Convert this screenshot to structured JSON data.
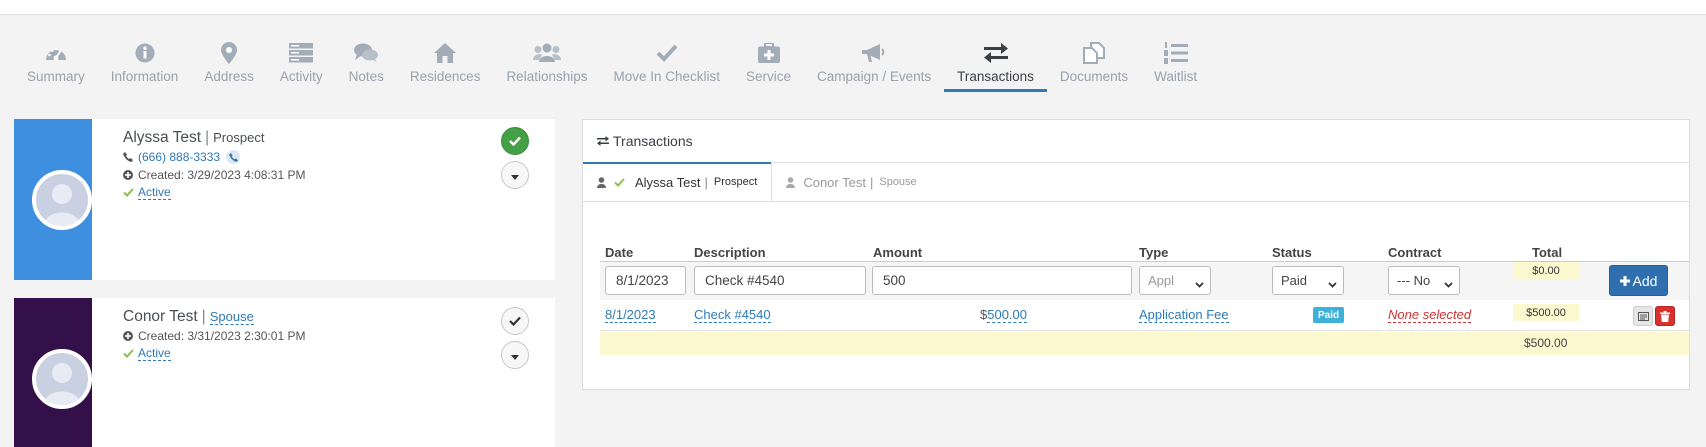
{
  "tabs": [
    {
      "label": "Summary",
      "icon": "dashboard-icon"
    },
    {
      "label": "Information",
      "icon": "info-icon"
    },
    {
      "label": "Address",
      "icon": "map-marker-icon"
    },
    {
      "label": "Activity",
      "icon": "server-icon"
    },
    {
      "label": "Notes",
      "icon": "comments-icon"
    },
    {
      "label": "Residences",
      "icon": "home-icon"
    },
    {
      "label": "Relationships",
      "icon": "users-icon"
    },
    {
      "label": "Move In Checklist",
      "icon": "check-icon"
    },
    {
      "label": "Service",
      "icon": "medkit-icon"
    },
    {
      "label": "Campaign / Events",
      "icon": "bullhorn-icon"
    },
    {
      "label": "Transactions",
      "icon": "exchange-icon"
    },
    {
      "label": "Documents",
      "icon": "files-icon"
    },
    {
      "label": "Waitlist",
      "icon": "list-ol-icon"
    }
  ],
  "active_tab": "Transactions",
  "people": [
    {
      "name": "Alyssa Test",
      "separator": "|",
      "relation": "Prospect",
      "phone": "(666) 888-3333",
      "created": "Created: 3/29/2023 4:08:31 PM",
      "status": "Active",
      "strip_color": "#3f8fe0"
    },
    {
      "name": "Conor Test",
      "separator": "|",
      "relation": "Spouse",
      "created": "Created: 3/31/2023 2:30:01 PM",
      "status": "Active",
      "strip_color": "#34104a"
    }
  ],
  "transactions": {
    "title": "Transactions",
    "subtabs": [
      {
        "name": "Alyssa Test",
        "sep": "|",
        "relation": "Prospect"
      },
      {
        "name": "Conor Test",
        "sep": "|",
        "relation": "Spouse"
      }
    ],
    "headers": {
      "date": "Date",
      "description": "Description",
      "amount": "Amount",
      "type": "Type",
      "status": "Status",
      "contract": "Contract",
      "total": "Total"
    },
    "new_row": {
      "date": "8/1/2023",
      "description": "Check #4540",
      "amount": "500",
      "type": "Appl",
      "status": "Paid",
      "contract": "--- No",
      "total": "$0.00",
      "add_label": "Add"
    },
    "rows": [
      {
        "date": "8/1/2023",
        "description": "Check #4540",
        "currency": "$",
        "amount": "500.00",
        "type": "Application Fee",
        "status": "Paid",
        "contract": "None selected",
        "total": "$500.00"
      }
    ],
    "sum": "$500.00"
  }
}
